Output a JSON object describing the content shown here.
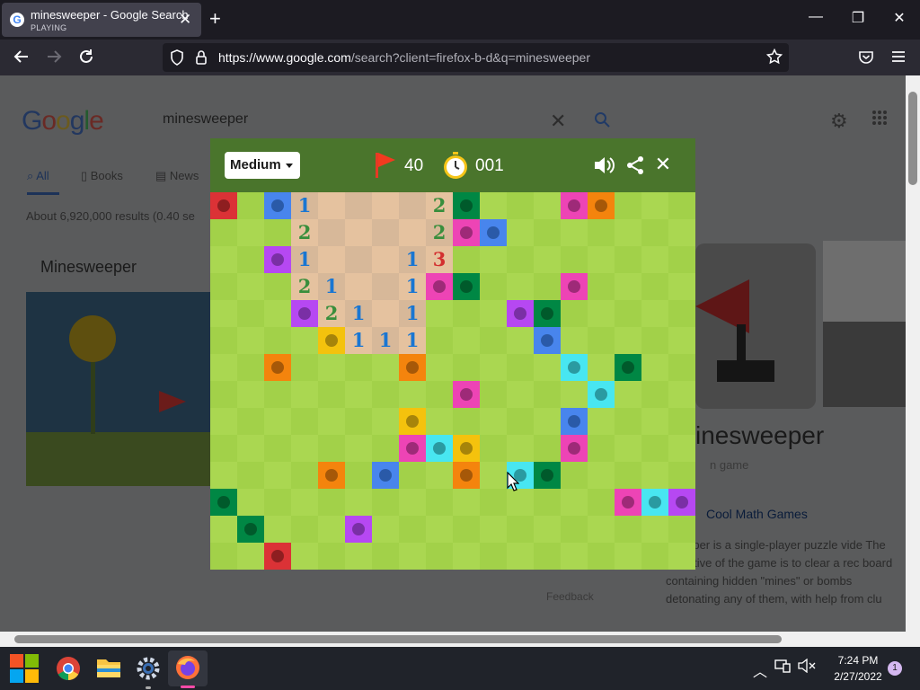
{
  "browser": {
    "tab_title": "minesweeper - Google Search",
    "tab_status": "PLAYING",
    "tab_close": "✕",
    "new_tab": "+",
    "url_host": "https://www.google.com",
    "url_rest": "/search?client=firefox-b-d&q=minesweeper",
    "window_minimize": "—",
    "window_restore": "❐",
    "window_close": "✕"
  },
  "google": {
    "logo": [
      "G",
      "o",
      "o",
      "g",
      "l",
      "e"
    ],
    "query": "minesweeper",
    "tabs": [
      {
        "label": "All"
      },
      {
        "label": "Books"
      },
      {
        "label": "News"
      }
    ],
    "results_count": "About 6,920,000 results (0.40 se",
    "kp_title_left": "Minesweeper",
    "kp_right_title": "inesweeper",
    "kp_right_subtitle": "n game",
    "kp_right_link": "Cool Math Games",
    "kp_desc": "sweeper is a single-player puzzle vide The objective of the game is to clear a rec board containing hidden \"mines\" or bombs detonating any of them, with help from clu",
    "feedback": "Feedback"
  },
  "game": {
    "difficulty": "Medium",
    "flags_remaining": "40",
    "timer": "001",
    "colors": {
      "light_grass": "#aad751",
      "dark_grass": "#a2d149",
      "light_dirt": "#e5c29f",
      "dark_dirt": "#d7b899",
      "header": "#4a752c"
    },
    "number_colors": {
      "1": "#1976d2",
      "2": "#388e3c",
      "3": "#d32f2f"
    },
    "revealed": [
      [
        3,
        0,
        "1"
      ],
      [
        4,
        0,
        ""
      ],
      [
        5,
        0,
        ""
      ],
      [
        6,
        0,
        ""
      ],
      [
        7,
        0,
        ""
      ],
      [
        8,
        0,
        "2"
      ],
      [
        3,
        1,
        "2"
      ],
      [
        4,
        1,
        ""
      ],
      [
        5,
        1,
        ""
      ],
      [
        6,
        1,
        ""
      ],
      [
        7,
        1,
        ""
      ],
      [
        8,
        1,
        "2"
      ],
      [
        3,
        2,
        "1"
      ],
      [
        4,
        2,
        ""
      ],
      [
        5,
        2,
        ""
      ],
      [
        6,
        2,
        ""
      ],
      [
        7,
        2,
        "1"
      ],
      [
        8,
        2,
        "3"
      ],
      [
        3,
        3,
        "2"
      ],
      [
        4,
        3,
        "1"
      ],
      [
        5,
        3,
        ""
      ],
      [
        6,
        3,
        ""
      ],
      [
        7,
        3,
        "1"
      ],
      [
        4,
        4,
        "2"
      ],
      [
        5,
        4,
        "1"
      ],
      [
        6,
        4,
        ""
      ],
      [
        7,
        4,
        "1"
      ],
      [
        5,
        5,
        "1"
      ],
      [
        6,
        5,
        "1"
      ],
      [
        7,
        5,
        "1"
      ]
    ],
    "mines": [
      [
        0,
        0,
        "#db3236",
        "#8e1e20"
      ],
      [
        2,
        0,
        "#4885ed",
        "#2a5aa8"
      ],
      [
        9,
        0,
        "#008744",
        "#005a2b"
      ],
      [
        13,
        0,
        "#ed44b5",
        "#9e2a78"
      ],
      [
        14,
        0,
        "#f4840d",
        "#a65808"
      ],
      [
        9,
        1,
        "#ed44b5",
        "#9e2a78"
      ],
      [
        10,
        1,
        "#4885ed",
        "#2a5aa8"
      ],
      [
        2,
        2,
        "#b648f2",
        "#7a2fa5"
      ],
      [
        8,
        3,
        "#ed44b5",
        "#9e2a78"
      ],
      [
        9,
        3,
        "#008744",
        "#005a2b"
      ],
      [
        13,
        3,
        "#ed44b5",
        "#9e2a78"
      ],
      [
        3,
        4,
        "#b648f2",
        "#7a2fa5"
      ],
      [
        11,
        4,
        "#b648f2",
        "#7a2fa5"
      ],
      [
        12,
        4,
        "#008744",
        "#005a2b"
      ],
      [
        4,
        5,
        "#f4c20d",
        "#a6840a"
      ],
      [
        12,
        5,
        "#4885ed",
        "#2a5aa8"
      ],
      [
        2,
        6,
        "#f4840d",
        "#a65808"
      ],
      [
        7,
        6,
        "#f4840d",
        "#a65808"
      ],
      [
        13,
        6,
        "#48e6f1",
        "#2a9aa1"
      ],
      [
        15,
        6,
        "#008744",
        "#005a2b"
      ],
      [
        9,
        7,
        "#ed44b5",
        "#9e2a78"
      ],
      [
        14,
        7,
        "#48e6f1",
        "#2a9aa1"
      ],
      [
        7,
        8,
        "#f4c20d",
        "#a6840a"
      ],
      [
        13,
        8,
        "#4885ed",
        "#2a5aa8"
      ],
      [
        7,
        9,
        "#ed44b5",
        "#9e2a78"
      ],
      [
        8,
        9,
        "#48e6f1",
        "#2a9aa1"
      ],
      [
        9,
        9,
        "#f4c20d",
        "#a6840a"
      ],
      [
        13,
        9,
        "#ed44b5",
        "#9e2a78"
      ],
      [
        4,
        10,
        "#f4840d",
        "#a65808"
      ],
      [
        6,
        10,
        "#4885ed",
        "#2a5aa8"
      ],
      [
        9,
        10,
        "#f4840d",
        "#a65808"
      ],
      [
        11,
        10,
        "#48e6f1",
        "#2a9aa1"
      ],
      [
        12,
        10,
        "#008744",
        "#005a2b"
      ],
      [
        0,
        11,
        "#008744",
        "#005a2b"
      ],
      [
        15,
        11,
        "#ed44b5",
        "#9e2a78"
      ],
      [
        16,
        11,
        "#48e6f1",
        "#2a9aa1"
      ],
      [
        17,
        11,
        "#b648f2",
        "#7a2fa5"
      ],
      [
        1,
        12,
        "#008744",
        "#005a2b"
      ],
      [
        5,
        12,
        "#b648f2",
        "#7a2fa5"
      ],
      [
        2,
        13,
        "#db3236",
        "#8e1e20"
      ]
    ]
  },
  "taskbar": {
    "time": "7:24 PM",
    "date": "2/27/2022",
    "notifications": "1"
  }
}
